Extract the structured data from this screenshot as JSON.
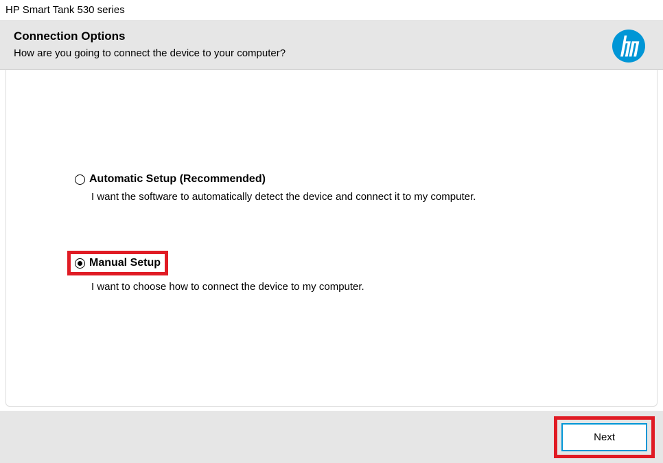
{
  "window": {
    "title": "HP Smart Tank 530 series"
  },
  "header": {
    "title": "Connection Options",
    "subtitle": "How are you going to connect the device to your computer?"
  },
  "options": {
    "automatic": {
      "label": "Automatic Setup (Recommended)",
      "description": "I want the software to automatically detect the device and connect it to my computer.",
      "selected": false
    },
    "manual": {
      "label": "Manual Setup",
      "description": "I want to choose how to connect the device to my computer.",
      "selected": true
    }
  },
  "footer": {
    "next_label": "Next"
  },
  "colors": {
    "highlight": "#e01b24",
    "hp_blue": "#0096d6"
  }
}
